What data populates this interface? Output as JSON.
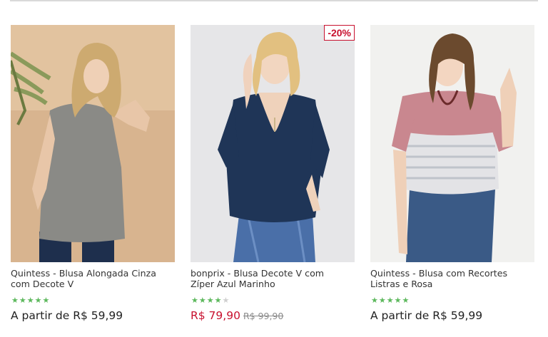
{
  "products": [
    {
      "title_line1": "Quintess - Blusa Alongada Cinza",
      "title_line2": "com Decote V",
      "rating": 4.5,
      "price": "A partir de R$ 59,99"
    },
    {
      "title_line1": "bonprix - Blusa Decote V com",
      "title_line2": "Zíper Azul Marinho",
      "rating": 4,
      "badge": "-20%",
      "price": "R$ 79,90",
      "old_price": "R$ 99,90"
    },
    {
      "title_line1": "Quintess - Blusa com Recortes",
      "title_line2": "Listras e Rosa",
      "rating": 4.5,
      "price": "A partir de R$ 59,99"
    }
  ],
  "colors": {
    "rating_star": "#5cb85c",
    "sale_price": "#c8102e",
    "badge": "#c8102e"
  }
}
